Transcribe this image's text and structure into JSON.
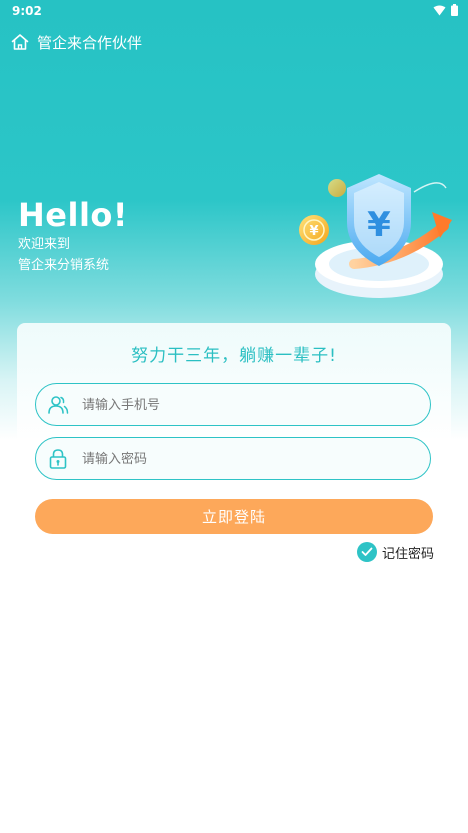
{
  "status_bar": {
    "time": "9:02"
  },
  "header": {
    "title": "管企来合作伙伴",
    "icon": "home-icon"
  },
  "hero": {
    "greeting": "Hello!",
    "line1": "欢迎来到",
    "line2": "管企来分销系统",
    "illustration_symbol": "¥"
  },
  "login_card": {
    "slogan": "努力干三年，躺赚一辈子!",
    "phone_placeholder": "请输入手机号",
    "password_placeholder": "请输入密码",
    "login_label": "立即登陆",
    "remember_label": "记住密码",
    "remember_checked": true
  },
  "colors": {
    "brand_teal": "#2ec3c6",
    "button_orange": "#fda85a"
  }
}
